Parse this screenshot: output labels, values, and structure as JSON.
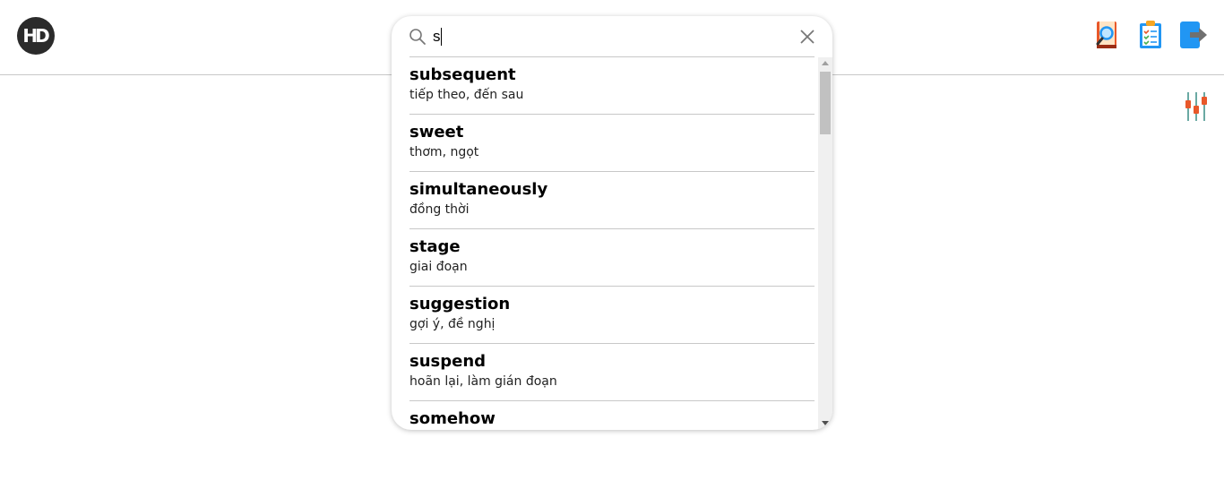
{
  "header": {
    "logo_text": "HD",
    "icons": [
      "dictionary-search-icon",
      "clipboard-checklist-icon",
      "logout-icon"
    ]
  },
  "filter": {
    "icon": "sliders-filter-icon"
  },
  "search": {
    "value": "s",
    "placeholder": "",
    "search_icon": "search-icon",
    "clear_icon": "close-icon"
  },
  "results": [
    {
      "word": "subsequent",
      "meaning": "tiếp theo, đến sau"
    },
    {
      "word": "sweet",
      "meaning": "thơm, ngọt"
    },
    {
      "word": "simultaneously",
      "meaning": "đồng thời"
    },
    {
      "word": "stage",
      "meaning": "giai đoạn"
    },
    {
      "word": "suggestion",
      "meaning": "gợi ý, đề nghị"
    },
    {
      "word": "suspend",
      "meaning": "hoãn lại, làm gián đoạn"
    },
    {
      "word": "somehow",
      "meaning": ""
    }
  ],
  "colors": {
    "logo_bg": "#2b2b2b",
    "accent_blue": "#2196f3",
    "accent_orange": "#e8582a",
    "divider": "#c8c8c8"
  }
}
